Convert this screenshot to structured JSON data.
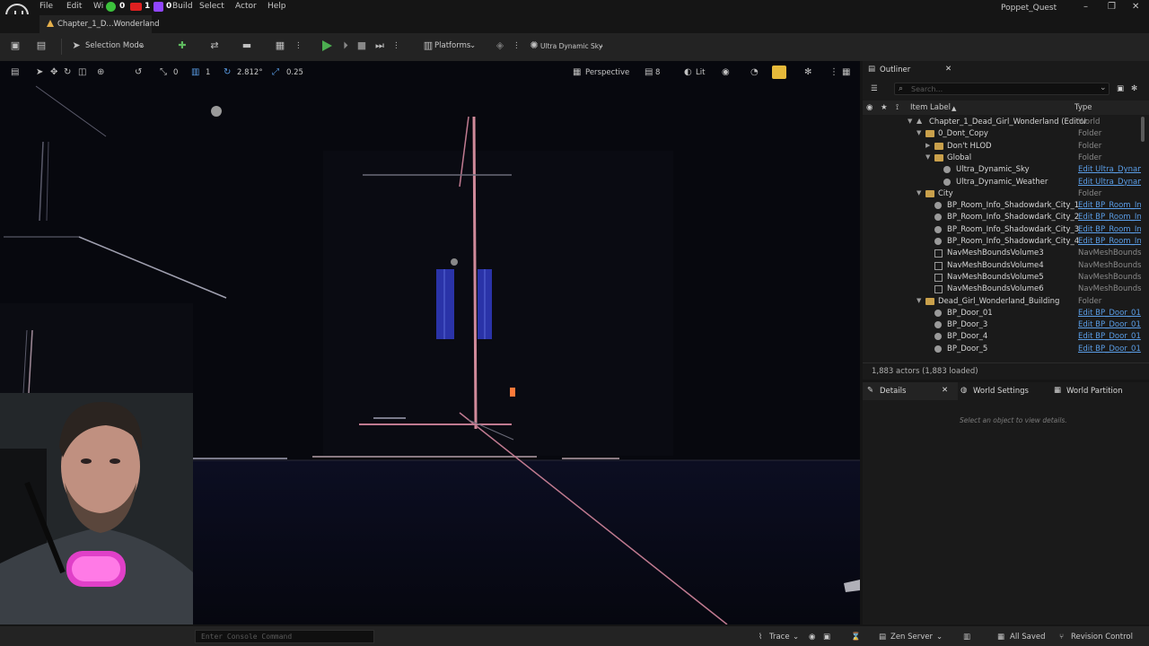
{
  "menu": {
    "items": [
      "File",
      "Edit",
      "Wi",
      "Build",
      "Select",
      "Actor",
      "Help"
    ],
    "overlay_counts": [
      "0",
      "1",
      "0"
    ]
  },
  "window": {
    "title": "Poppet_Quest"
  },
  "level_tab": {
    "label": "Chapter_1_D...Wonderland"
  },
  "toolbar": {
    "selection_mode": "Selection Mode",
    "platforms": "Platforms",
    "sky": "Ultra Dynamic Sky"
  },
  "viewport_toolbar": {
    "rot_snap": "0",
    "grid_snap": "1",
    "scale_value": "2.812°",
    "scale_snap": "0.25",
    "perspective": "Perspective",
    "camera_speed": "8",
    "lit": "Lit"
  },
  "outliner": {
    "tab_label": "Outliner",
    "search_placeholder": "Search...",
    "col_label": "Item Label",
    "col_type": "Type",
    "rows": [
      {
        "label": "Chapter_1_Dead_Girl_Wonderland (Editor",
        "type": "World"
      },
      {
        "label": "0_Dont_Copy",
        "type": "Folder"
      },
      {
        "label": "Don't HLOD",
        "type": "Folder"
      },
      {
        "label": "Global",
        "type": "Folder"
      },
      {
        "label": "Ultra_Dynamic_Sky",
        "type": "Edit Ultra_Dynami"
      },
      {
        "label": "Ultra_Dynamic_Weather",
        "type": "Edit Ultra_Dynami"
      },
      {
        "label": "City",
        "type": "Folder"
      },
      {
        "label": "BP_Room_Info_Shadowdark_City_1",
        "type": "Edit BP_Room_Inf"
      },
      {
        "label": "BP_Room_Info_Shadowdark_City_2",
        "type": "Edit BP_Room_Inf"
      },
      {
        "label": "BP_Room_Info_Shadowdark_City_3",
        "type": "Edit BP_Room_Inf"
      },
      {
        "label": "BP_Room_Info_Shadowdark_City_4",
        "type": "Edit BP_Room_Inf"
      },
      {
        "label": "NavMeshBoundsVolume3",
        "type": "NavMeshBounds\\"
      },
      {
        "label": "NavMeshBoundsVolume4",
        "type": "NavMeshBounds\\"
      },
      {
        "label": "NavMeshBoundsVolume5",
        "type": "NavMeshBounds\\"
      },
      {
        "label": "NavMeshBoundsVolume6",
        "type": "NavMeshBounds\\"
      },
      {
        "label": "Dead_Girl_Wonderland_Building",
        "type": "Folder"
      },
      {
        "label": "BP_Door_01",
        "type": "Edit BP_Door_01"
      },
      {
        "label": "BP_Door_3",
        "type": "Edit BP_Door_01"
      },
      {
        "label": "BP_Door_4",
        "type": "Edit BP_Door_01"
      },
      {
        "label": "BP_Door_5",
        "type": "Edit BP_Door_01"
      }
    ],
    "actor_count": "1,883 actors (1,883 loaded)"
  },
  "details": {
    "tab_label": "Details",
    "world_settings": "World Settings",
    "world_partition": "World Partition",
    "empty_hint": "Select an object to view details."
  },
  "status": {
    "console_placeholder": "Enter Console Command",
    "trace": "Trace",
    "zen": "Zen Server",
    "saved": "All Saved",
    "revision": "Revision Control"
  }
}
